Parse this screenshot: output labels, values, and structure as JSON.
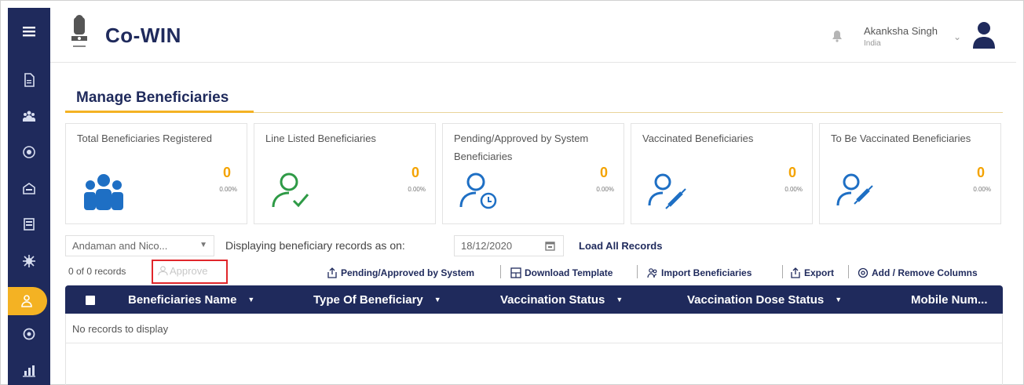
{
  "header": {
    "brand": "Co-WIN",
    "user_name": "Akanksha Singh",
    "user_country": "India"
  },
  "sidebar": {
    "items": [
      {
        "icon": "menu-icon"
      },
      {
        "icon": "document-icon"
      },
      {
        "icon": "people-icon"
      },
      {
        "icon": "globe-icon"
      },
      {
        "icon": "building-icon"
      },
      {
        "icon": "storage-icon"
      },
      {
        "icon": "virus-icon"
      },
      {
        "icon": "beneficiaries-icon",
        "active": true
      },
      {
        "icon": "settings-icon"
      },
      {
        "icon": "reports-icon"
      }
    ]
  },
  "page": {
    "title": "Manage Beneficiaries"
  },
  "cards": [
    {
      "title": "Total Beneficiaries Registered",
      "count": "0",
      "pct": "0.00%",
      "icon": "people-group-icon"
    },
    {
      "title": "Line Listed Beneficiaries",
      "count": "0",
      "pct": "0.00%",
      "icon": "person-check-icon"
    },
    {
      "title": "Pending/Approved by System Beneficiaries",
      "count": "0",
      "pct": "0.00%",
      "icon": "person-clock-icon"
    },
    {
      "title": "Vaccinated Beneficiaries",
      "count": "0",
      "pct": "0.00%",
      "icon": "person-syringe-icon"
    },
    {
      "title": "To Be Vaccinated Beneficiaries",
      "count": "0",
      "pct": "0.00%",
      "icon": "person-syringe-icon"
    }
  ],
  "filters": {
    "state": "Andaman and Nico...",
    "display_label": "Displaying beneficiary records as on:",
    "date": "18/12/2020",
    "load_all": "Load All Records"
  },
  "records": {
    "count_text": "0 of 0 records",
    "approve": "Approve"
  },
  "toolbar": {
    "pending": "Pending/Approved by System",
    "download": "Download Template",
    "import": "Import Beneficiaries",
    "export": "Export",
    "columns": "Add / Remove Columns"
  },
  "table": {
    "columns": [
      "Beneficiaries Name",
      "Type Of Beneficiary",
      "Vaccination Status",
      "Vaccination Dose Status",
      "Mobile Num..."
    ],
    "empty": "No records to display"
  },
  "colors": {
    "navy": "#1f2a5c",
    "accent": "#f4b223",
    "highlight": "#e0262b"
  }
}
